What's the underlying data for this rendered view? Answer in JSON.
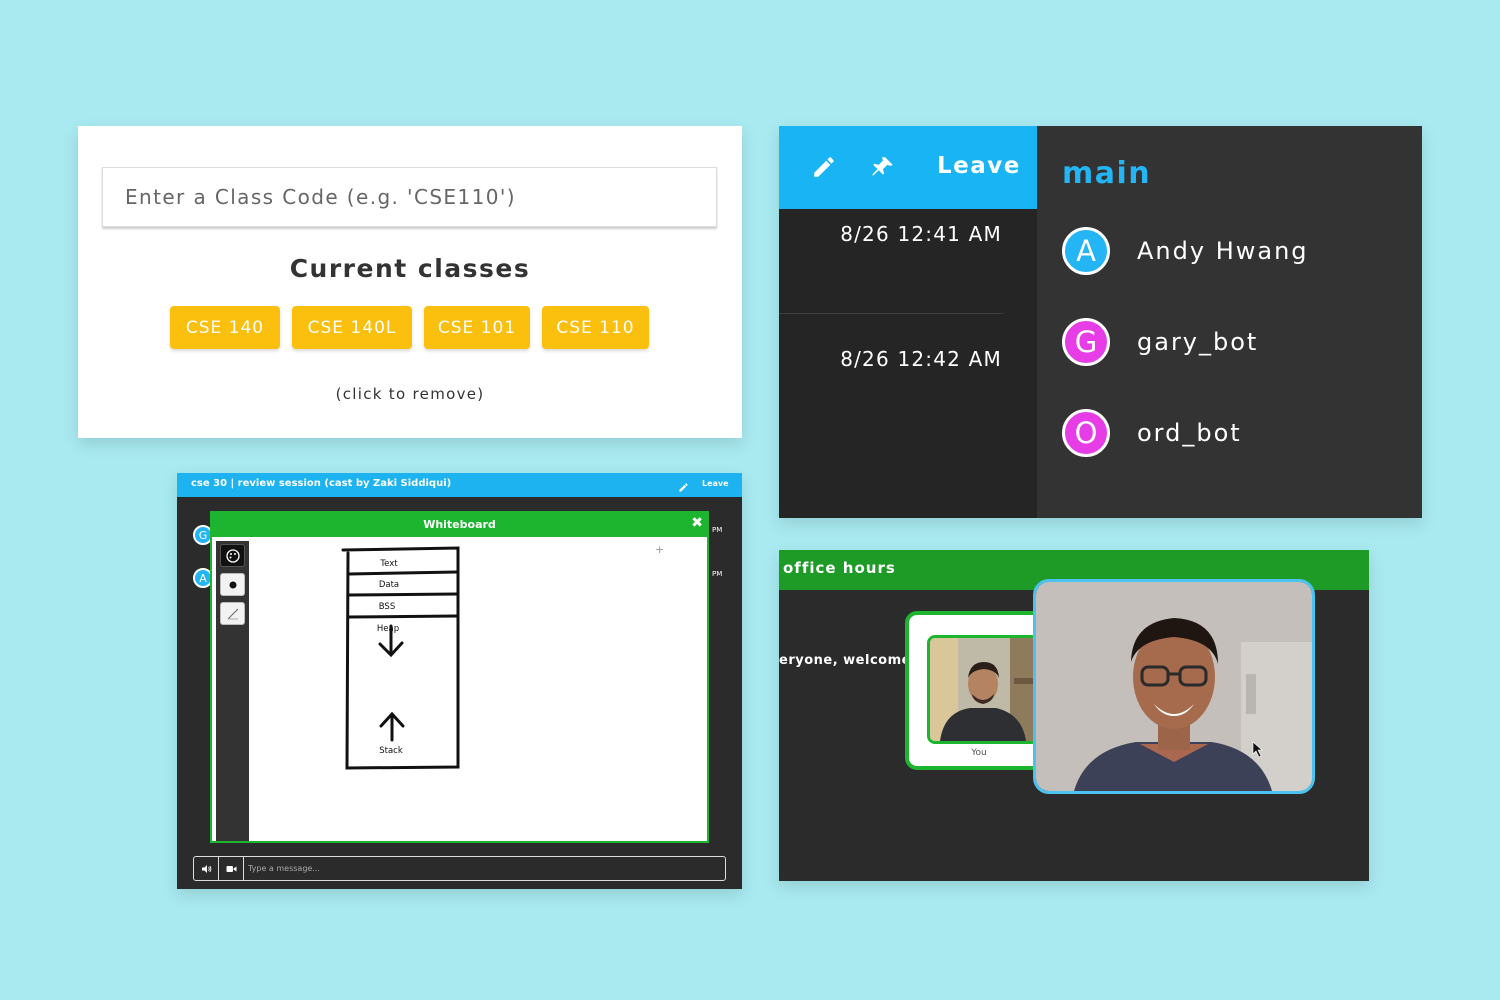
{
  "class_panel": {
    "input_placeholder": "Enter a Class Code (e.g. 'CSE110')",
    "title": "Current classes",
    "chips": [
      "CSE 140",
      "CSE 140L",
      "CSE 101",
      "CSE 110"
    ],
    "hint": "(click to remove)",
    "chip_color": "#fbbf0e"
  },
  "chat_panel": {
    "leave_label": "Leave",
    "edit_icon": "pencil-icon",
    "pin_icon": "pin-icon",
    "times": [
      "8/26 12:41 AM",
      "8/26 12:42 AM"
    ],
    "room_name": "main",
    "users": [
      {
        "initial": "A",
        "name": "Andy Hwang",
        "color": "#23b5f5"
      },
      {
        "initial": "G",
        "name": "gary_bot",
        "color": "#e63de6"
      },
      {
        "initial": "O",
        "name": "ord_bot",
        "color": "#e63de6"
      }
    ]
  },
  "whiteboard_panel": {
    "session_title": "cse 30 | review session (cast by Zaki Siddiqui)",
    "leave_label": "Leave",
    "side_avatars": [
      "G",
      "A"
    ],
    "side_times": [
      "PM",
      "PM"
    ],
    "window_title": "Whiteboard",
    "close_icon": "close-icon",
    "tools": [
      "palette-icon",
      "dot-icon",
      "line-icon"
    ],
    "drawing_labels": [
      "Text",
      "Data",
      "BSS",
      "Heap",
      "Stack"
    ],
    "message_placeholder": "Type a message...",
    "input_icons": [
      "speaker-icon",
      "video-icon"
    ]
  },
  "video_panel": {
    "title": "office hours",
    "message_fragment": "eryone, welcome",
    "you_label": "You"
  }
}
